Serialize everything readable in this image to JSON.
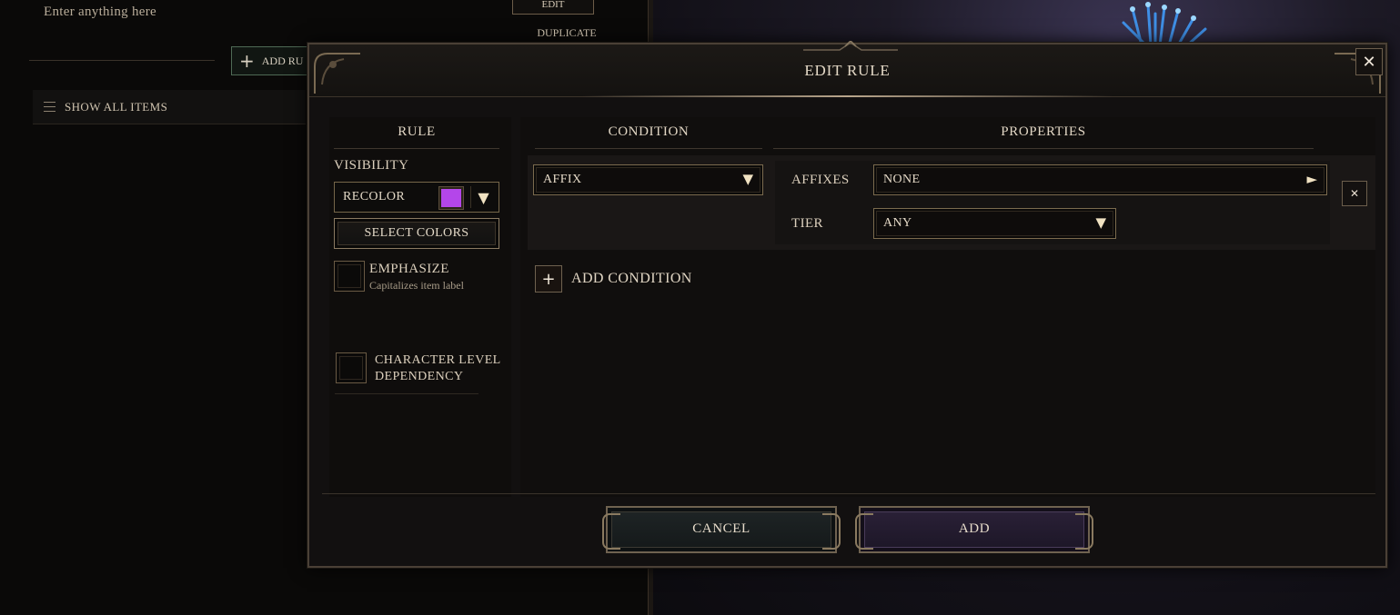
{
  "background": {
    "description_placeholder": "Enter anything here",
    "add_rule_label": "ADD RU",
    "edit_label": "EDIT",
    "duplicate_label": "DUPLICATE",
    "show_all_items_label": "SHOW ALL ITEMS"
  },
  "modal": {
    "title": "EDIT RULE",
    "close_icon": "close-icon",
    "columns": {
      "rule": "RULE",
      "condition": "CONDITION",
      "properties": "PROPERTIES"
    },
    "rule": {
      "visibility_label": "VISIBILITY",
      "visibility_value": "RECOLOR",
      "swatch_color": "#b446ea",
      "select_colors_label": "SELECT COLORS",
      "emphasize_label": "EMPHASIZE",
      "emphasize_sub": "Capitalizes item label",
      "emphasize_checked": false,
      "char_level_label_1": "CHARACTER LEVEL",
      "char_level_label_2": "DEPENDENCY",
      "char_level_checked": false
    },
    "condition": {
      "type_value": "AFFIX",
      "affixes_label": "AFFIXES",
      "affixes_value": "NONE",
      "tier_label": "TIER",
      "tier_value": "ANY",
      "add_condition_label": "ADD CONDITION"
    },
    "footer": {
      "cancel_label": "CANCEL",
      "add_label": "ADD"
    }
  },
  "colors": {
    "accent_gold": "#7b6b4e",
    "add_button_purple": "#2b2138",
    "cancel_button_slate": "#1f2526"
  }
}
